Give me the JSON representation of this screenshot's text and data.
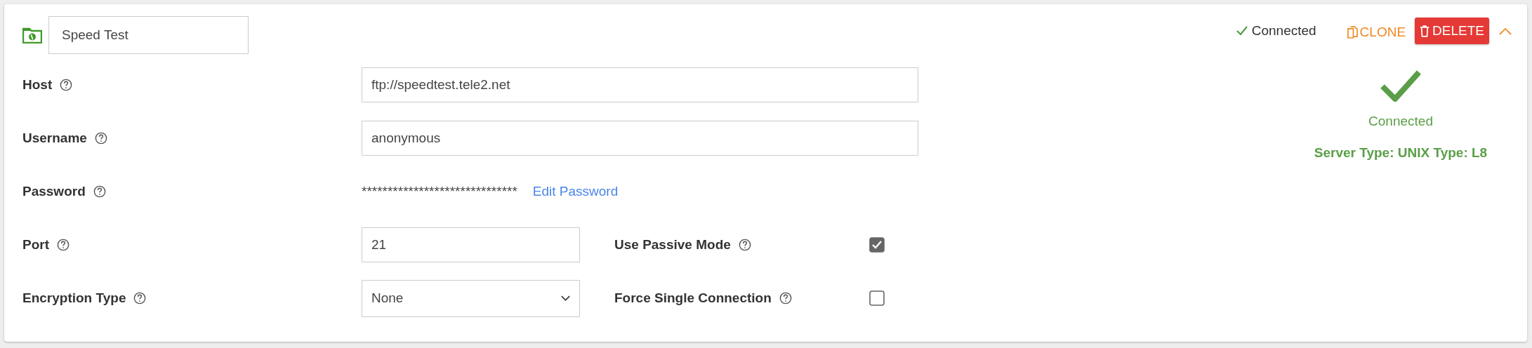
{
  "header": {
    "name": "Speed Test",
    "status": "Connected",
    "clone": "CLONE",
    "delete": "DELETE",
    "expanded": true
  },
  "fields": [
    {
      "kind": "text",
      "label": "Host",
      "value": "ftp://speedtest.tele2.net"
    },
    {
      "kind": "text",
      "label": "Username",
      "value": "anonymous"
    },
    {
      "kind": "password",
      "label": "Password",
      "value": "******************************",
      "link": "Edit Password"
    },
    {
      "kind": "short",
      "label": "Port",
      "value": "21",
      "option": {
        "label": "Use Passive Mode",
        "checked": true
      }
    },
    {
      "kind": "select",
      "label": "Encryption Type",
      "value": "None",
      "option": {
        "label": "Force Single Connection",
        "checked": false
      }
    }
  ],
  "connection": {
    "status": "Connected",
    "detail": "Server Type: UNIX Type: L8"
  }
}
